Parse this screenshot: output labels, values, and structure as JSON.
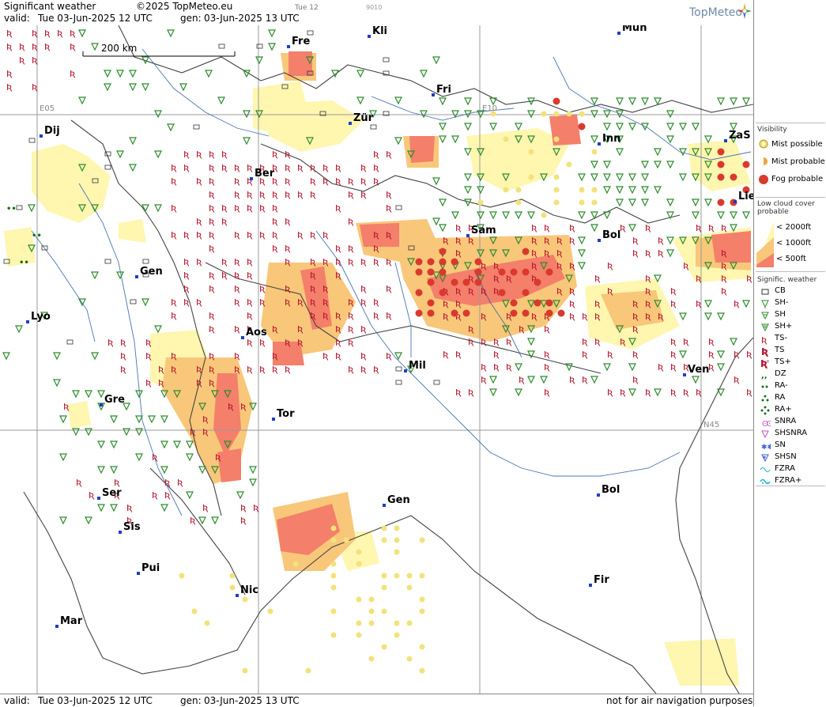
{
  "header": {
    "title": "Significant weather",
    "copyright": "©2025 TopMeteo.eu",
    "tag_small": "Tue 12",
    "tag_code": "9010",
    "valid_label": "valid:",
    "valid_value": "Tue  03-Jun-2025  12 UTC",
    "gen_label": "gen:",
    "gen_value": "03-Jun-2025 13 UTC",
    "logo": "TopMeteo"
  },
  "footer": {
    "valid_label": "valid:",
    "valid_value": "Tue  03-Jun-2025  12 UTC",
    "gen_label": "gen:",
    "gen_value": "03-Jun-2025 13 UTC",
    "disclaimer": "not for air navigation purposes"
  },
  "map": {
    "scale_label": "200 km",
    "grid_labels": [
      "E05",
      "E10",
      "N45"
    ],
    "cities": [
      {
        "name": "Fre"
      },
      {
        "name": "Kli"
      },
      {
        "name": "Mun"
      },
      {
        "name": "Fri"
      },
      {
        "name": "Dij"
      },
      {
        "name": "Zür"
      },
      {
        "name": "Inn"
      },
      {
        "name": "ZaS"
      },
      {
        "name": "Ber"
      },
      {
        "name": "Lie"
      },
      {
        "name": "Sam"
      },
      {
        "name": "Bol"
      },
      {
        "name": "Gen"
      },
      {
        "name": "Lyo"
      },
      {
        "name": "Aos"
      },
      {
        "name": "Mil"
      },
      {
        "name": "Ven"
      },
      {
        "name": "Gre"
      },
      {
        "name": "Tor"
      },
      {
        "name": "Gen"
      },
      {
        "name": "Bol"
      },
      {
        "name": "Ser"
      },
      {
        "name": "Sis"
      },
      {
        "name": "Pui"
      },
      {
        "name": "Nic"
      },
      {
        "name": "Fir"
      },
      {
        "name": "Mar"
      }
    ]
  },
  "legend": {
    "visibility_title": "Visibility",
    "visibility_items": [
      "Mist possible",
      "Mist probable",
      "Fog probable"
    ],
    "lowcloud_title": "Low cloud cover probable",
    "lowcloud_items": [
      "< 2000ft",
      "< 1000ft",
      "<  500ft"
    ],
    "sigwx_title": "Signific. weather",
    "sigwx_items": [
      "CB",
      "SH-",
      "SH",
      "SH+",
      "TS-",
      "TS",
      "TS+",
      "DZ",
      "RA-",
      "RA",
      "RA+",
      "SNRA",
      "SHSNRA",
      "SN",
      "SHSN",
      "FZRA",
      "FZRA+"
    ],
    "colors": {
      "mist_possible": "#f2e27a",
      "mist_probable": "#f2a23c",
      "fog": "#d9392e",
      "lc_2000": "#fff6b0",
      "lc_1000": "#f9c77a",
      "lc_500": "#f47f6a",
      "ts": "#b3122a",
      "sh": "#2e8b2e",
      "ra": "#1a6e1a",
      "sn": "#c257c2",
      "fz": "#1ab8d9"
    }
  }
}
